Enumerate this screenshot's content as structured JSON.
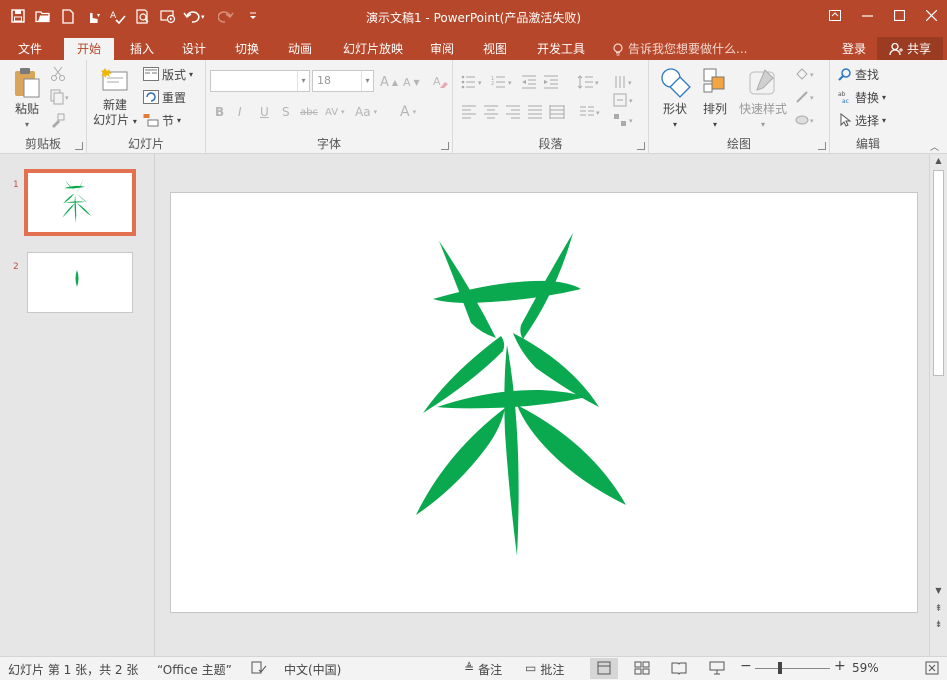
{
  "window": {
    "title": "演示文稿1 - PowerPoint(产品激活失败)",
    "accent": "#b7472a"
  },
  "qat": [
    {
      "name": "save-icon"
    },
    {
      "name": "open-icon"
    },
    {
      "name": "new-icon"
    },
    {
      "name": "touch-mode-icon"
    },
    {
      "name": "spelling-icon"
    },
    {
      "name": "preview-icon"
    },
    {
      "name": "slideshow-start-icon"
    },
    {
      "name": "undo-icon"
    },
    {
      "name": "redo-icon"
    },
    {
      "name": "customize-qat-icon"
    }
  ],
  "tabs": [
    "文件",
    "开始",
    "插入",
    "设计",
    "切换",
    "动画",
    "幻灯片放映",
    "审阅",
    "视图",
    "开发工具"
  ],
  "active_tab": "开始",
  "tell_me": "告诉我您想要做什么...",
  "login": "登录",
  "share": "共享",
  "ribbon": {
    "clipboard": {
      "label": "剪贴板",
      "paste": "粘贴"
    },
    "slides": {
      "label": "幻灯片",
      "new_slide_1": "新建",
      "new_slide_2": "幻灯片",
      "layout": "版式",
      "reset": "重置",
      "section": "节"
    },
    "font": {
      "label": "字体",
      "font_name": "",
      "font_size": "18"
    },
    "paragraph": {
      "label": "段落"
    },
    "drawing": {
      "label": "绘图",
      "shapes": "形状",
      "arrange": "排列",
      "quick_styles": "快速样式"
    },
    "editing": {
      "label": "编辑",
      "find": "查找",
      "replace": "替换",
      "select": "选择"
    }
  },
  "thumbnails": [
    {
      "num": "1",
      "selected": true
    },
    {
      "num": "2",
      "selected": false
    }
  ],
  "leaf_color": "#0aa84f",
  "status": {
    "slide_info": "幻灯片 第 1 张，共 2 张",
    "theme": "“Office 主题”",
    "language": "中文(中国)",
    "notes": "备注",
    "comments": "批注",
    "zoom": "59%"
  }
}
